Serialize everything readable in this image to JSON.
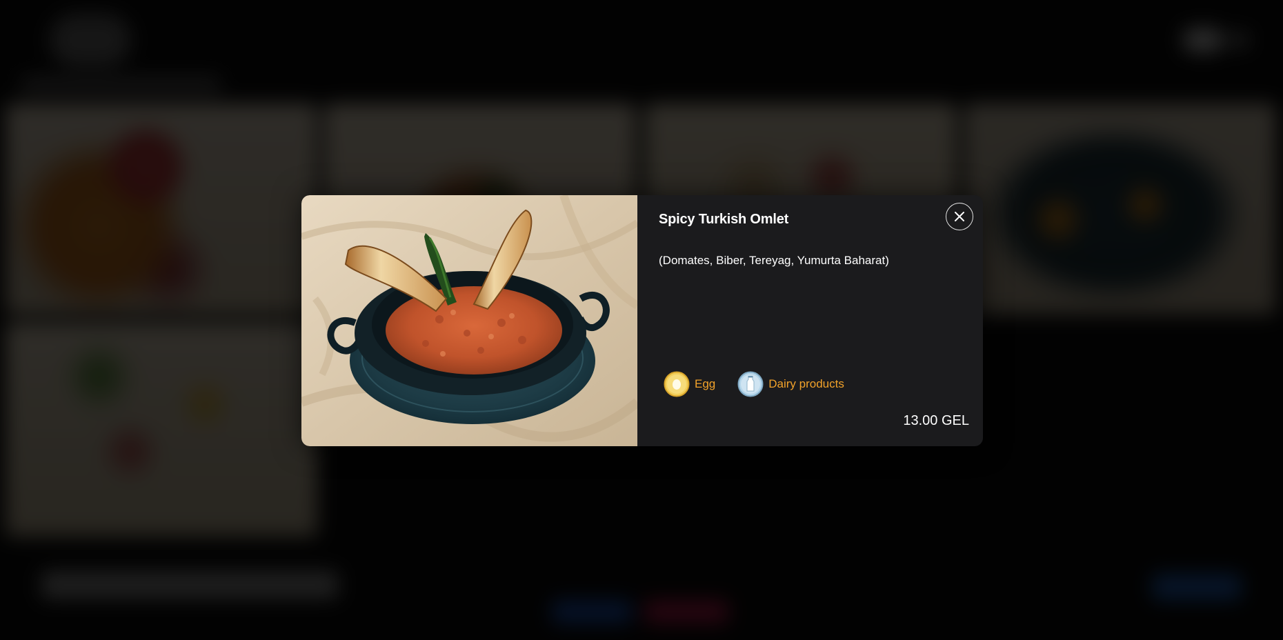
{
  "modal": {
    "title": "Spicy Turkish Omlet",
    "description": "(Domates, Biber, Tereyag, Yumurta Baharat)",
    "price": "13.00 GEL",
    "allergens": [
      {
        "label": "Egg",
        "icon": "egg-icon"
      },
      {
        "label": "Dairy products",
        "icon": "milk-bottle-icon"
      }
    ],
    "close_icon": "close-icon",
    "image": "spicy-turkish-omlet-photo"
  },
  "colors": {
    "modal_background": "#1b1b1d",
    "allergen_text": "#f2a22a",
    "text": "#ffffff"
  }
}
